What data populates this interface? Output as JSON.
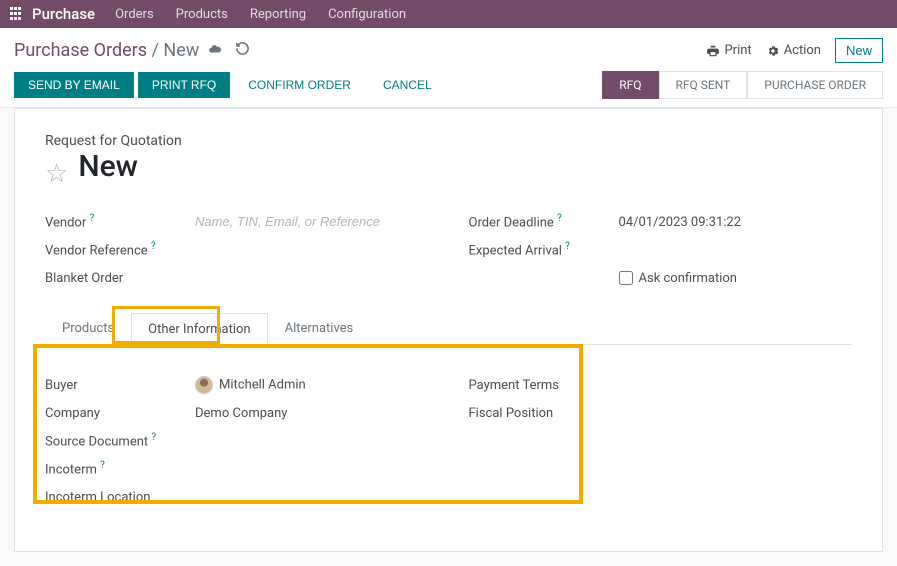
{
  "nav": {
    "brand": "Purchase",
    "items": [
      "Orders",
      "Products",
      "Reporting",
      "Configuration"
    ]
  },
  "breadcrumb": {
    "root": "Purchase Orders",
    "current": "New"
  },
  "header_buttons": {
    "print": "Print",
    "action": "Action",
    "new": "New"
  },
  "toolbar": {
    "send_email": "SEND BY EMAIL",
    "print_rfq": "PRINT RFQ",
    "confirm": "CONFIRM ORDER",
    "cancel": "CANCEL"
  },
  "status": {
    "rfq": "RFQ",
    "rfq_sent": "RFQ SENT",
    "po": "PURCHASE ORDER"
  },
  "sheet": {
    "subtitle": "Request for Quotation",
    "title": "New",
    "left": {
      "vendor_label": "Vendor",
      "vendor_placeholder": "Name, TIN, Email, or Reference",
      "vendor_ref_label": "Vendor Reference",
      "blanket_label": "Blanket Order"
    },
    "right": {
      "deadline_label": "Order Deadline",
      "deadline_value": "04/01/2023 09:31:22",
      "expected_label": "Expected Arrival",
      "ask_conf_label": "Ask confirmation"
    }
  },
  "tabs": {
    "products": "Products",
    "other": "Other Information",
    "alternatives": "Alternatives"
  },
  "other_info": {
    "left": {
      "buyer_label": "Buyer",
      "buyer_value": "Mitchell Admin",
      "company_label": "Company",
      "company_value": "Demo Company",
      "source_label": "Source Document",
      "incoterm_label": "Incoterm",
      "incoterm_loc_label": "Incoterm Location"
    },
    "right": {
      "payment_label": "Payment Terms",
      "fiscal_label": "Fiscal Position"
    }
  }
}
